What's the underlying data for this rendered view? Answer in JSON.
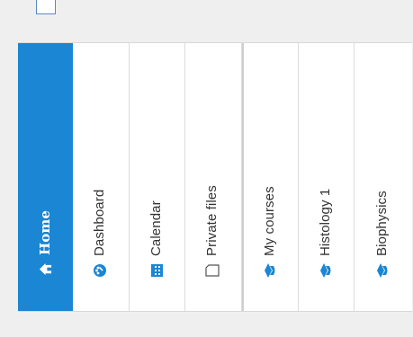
{
  "nav": {
    "items": [
      {
        "label": "Home",
        "icon": "home-icon",
        "active": true
      },
      {
        "label": "Dashboard",
        "icon": "dashboard-icon"
      },
      {
        "label": "Calendar",
        "icon": "calendar-icon"
      },
      {
        "label": "Private files",
        "icon": "file-icon"
      },
      {
        "label": "My courses",
        "icon": "graduation-cap-icon"
      },
      {
        "label": "Histology 1",
        "icon": "graduation-cap-icon"
      },
      {
        "label": "Biophysics",
        "icon": "graduation-cap-icon"
      }
    ]
  },
  "colors": {
    "accent": "#1a86d4",
    "background": "#efefef",
    "course_icon": "#1a86d4"
  }
}
